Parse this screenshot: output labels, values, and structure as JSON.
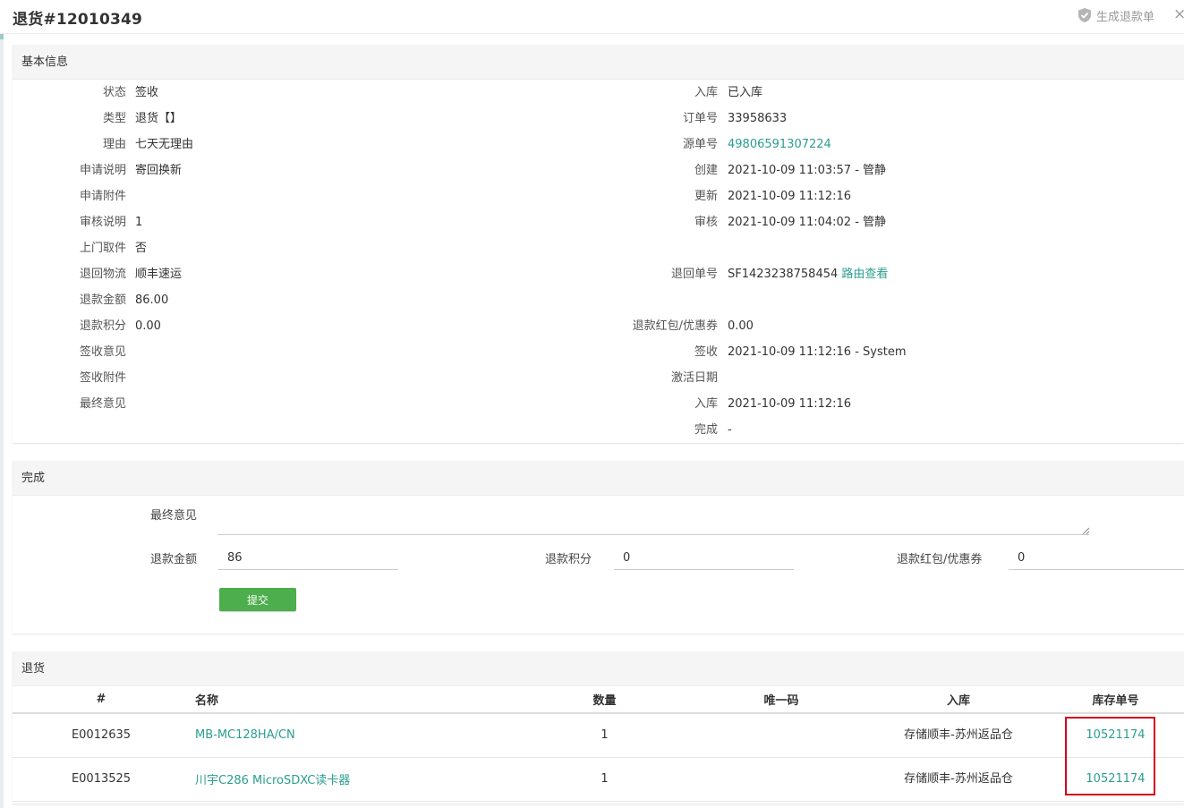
{
  "header": {
    "title": "退货#12010349",
    "generate_refund_label": "生成退款单",
    "close_glyph": "×",
    "icons": {
      "generate": "shield-check-icon",
      "close": "close-icon"
    }
  },
  "basic": {
    "section_title": "基本信息",
    "left": [
      {
        "label": "状态",
        "value": "签收"
      },
      {
        "label": "类型",
        "value": "退货【】"
      },
      {
        "label": "理由",
        "value": "七天无理由"
      },
      {
        "label": "申请说明",
        "value": "寄回换新"
      },
      {
        "label": "申请附件",
        "value": ""
      },
      {
        "label": "审核说明",
        "value": "1"
      },
      {
        "label": "上门取件",
        "value": "否"
      },
      {
        "label": "退回物流",
        "value": "顺丰速运"
      },
      {
        "label": "退款金额",
        "value": "86.00"
      },
      {
        "label": "退款积分",
        "value": "0.00"
      },
      {
        "label": "签收意见",
        "value": ""
      },
      {
        "label": "签收附件",
        "value": ""
      },
      {
        "label": "最终意见",
        "value": ""
      }
    ],
    "right": {
      "stock_in": {
        "label": "入库",
        "value": "已入库"
      },
      "order_no": {
        "label": "订单号",
        "value": "33958633"
      },
      "source_no": {
        "label": "源单号",
        "value": "49806591307224"
      },
      "created": {
        "label": "创建",
        "value": "2021-10-09 11:03:57 - 管静"
      },
      "updated": {
        "label": "更新",
        "value": "2021-10-09 11:12:16"
      },
      "audited": {
        "label": "审核",
        "value": "2021-10-09 11:04:02 - 管静"
      },
      "return_no": {
        "label": "退回单号",
        "value": "SF1423238758454",
        "link": "路由查看"
      },
      "refund_coupon": {
        "label": "退款红包/优惠券",
        "value": "0.00"
      },
      "signed": {
        "label": "签收",
        "value": "2021-10-09 11:12:16 - System"
      },
      "activated": {
        "label": "激活日期",
        "value": ""
      },
      "stocked": {
        "label": "入库",
        "value": "2021-10-09 11:12:16"
      },
      "done": {
        "label": "完成",
        "value": "-"
      }
    }
  },
  "finish": {
    "section_title": "完成",
    "final_opinion_label": "最终意见",
    "final_opinion_value": "",
    "refund_amount_label": "退款金额",
    "refund_amount_value": "86",
    "refund_points_label": "退款积分",
    "refund_points_value": "0",
    "refund_coupon_label": "退款红包/优惠券",
    "refund_coupon_value": "0",
    "submit_label": "提交"
  },
  "returns": {
    "section_title": "退货",
    "columns": [
      "#",
      "名称",
      "数量",
      "唯一码",
      "入库",
      "库存单号"
    ],
    "rows": [
      {
        "id": "E0012635",
        "name": "MB-MC128HA/CN",
        "qty": "1",
        "unique": "",
        "warehouse": "存储顺丰-苏州返品仓",
        "stock_no": "10521174"
      },
      {
        "id": "E0013525",
        "name": "川宇C286 MicroSDXC读卡器",
        "qty": "1",
        "unique": "",
        "warehouse": "存储顺丰-苏州返品仓",
        "stock_no": "10521174"
      }
    ]
  },
  "colors": {
    "link": "#2a9d8f",
    "submit": "#4cae4c",
    "highlight": "#d0021b"
  }
}
